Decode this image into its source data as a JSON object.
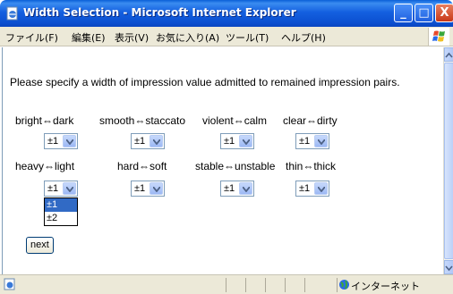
{
  "window": {
    "title": "Width Selection - Microsoft Internet Explorer",
    "controls": {
      "minimize": "_",
      "maximize": "□",
      "close": "X"
    }
  },
  "menu": {
    "items": [
      "ファイル(F)",
      "編集(E)",
      "表示(V)",
      "お気に入り(A)",
      "ツール(T)",
      "ヘルプ(H)"
    ]
  },
  "page": {
    "instruction": "Please specify a width of impression value admitted to remained impression pairs.",
    "pairs": [
      {
        "label": "bright⇔dark",
        "value": "±1"
      },
      {
        "label": "smooth⇔staccato",
        "value": "±1"
      },
      {
        "label": "violent⇔calm",
        "value": "±1"
      },
      {
        "label": "clear⇔dirty",
        "value": "±1"
      },
      {
        "label": "heavy⇔light",
        "value": "±1"
      },
      {
        "label": "hard⇔soft",
        "value": "±1"
      },
      {
        "label": "stable⇔unstable",
        "value": "±1"
      },
      {
        "label": "thin⇔thick",
        "value": "±1"
      }
    ],
    "open_dropdown": {
      "options": [
        "±1",
        "±2"
      ],
      "selected": "±1"
    },
    "next_label": "next"
  },
  "statusbar": {
    "zone": "インターネット"
  },
  "colors": {
    "titlebar": "#0b4fd0",
    "selected_option": "#316ac5"
  }
}
